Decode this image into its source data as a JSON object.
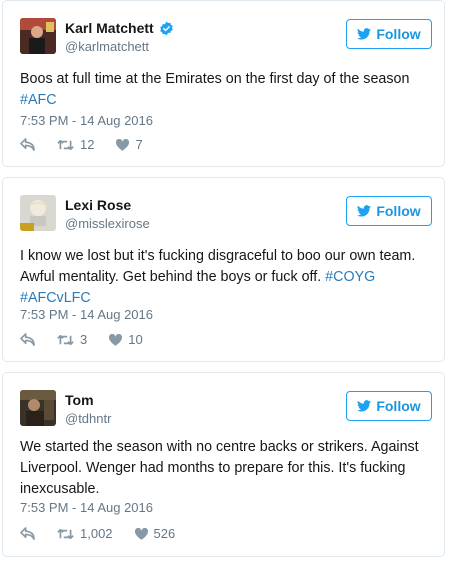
{
  "follow_label": "Follow",
  "colors": {
    "accent": "#1da1f2",
    "link": "#2b7bb9",
    "muted": "#657786",
    "verified": "#1da1f2"
  },
  "tweets": [
    {
      "name": "Karl Matchett",
      "verified": true,
      "handle": "@karlmatchett",
      "text_lines": [
        "Boos at full time at the Emirates on the first day of the season"
      ],
      "hashtags": [
        "#AFC"
      ],
      "timestamp": "7:53 PM - 14 Aug 2016",
      "retweets": "12",
      "likes": "7"
    },
    {
      "name": "Lexi Rose",
      "verified": false,
      "handle": "@misslexirose",
      "text_lines": [
        "I know we lost but it's fucking disgraceful to boo our own team.",
        "Awful mentality. Get behind the boys or fuck off. "
      ],
      "hashtags": [
        "#COYG",
        "#AFCvLFC"
      ],
      "timestamp": "7:53 PM - 14 Aug 2016",
      "retweets": "3",
      "likes": "10"
    },
    {
      "name": "Tom",
      "verified": false,
      "handle": "@tdhntr",
      "text_lines": [
        "We started the season with no centre backs or strikers. Against",
        "Liverpool. Wenger had months to prepare for this. It's fucking",
        "inexcusable."
      ],
      "hashtags": [],
      "timestamp": "7:53 PM - 14 Aug 2016",
      "retweets": "1,002",
      "likes": "526"
    }
  ]
}
